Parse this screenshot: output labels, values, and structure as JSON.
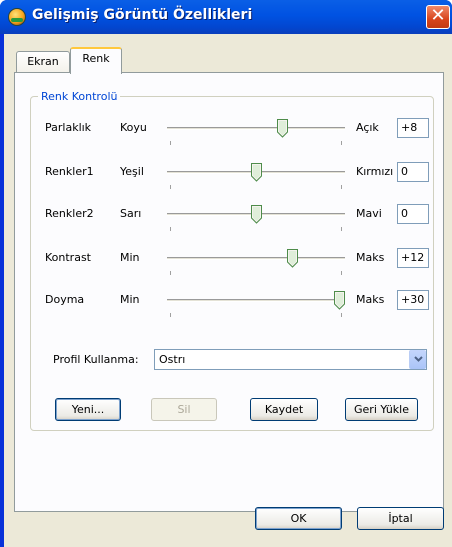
{
  "window": {
    "title": "Gelişmiş Görüntü Özellikleri",
    "close_glyph": "✕"
  },
  "tabs": [
    {
      "label": "Ekran"
    },
    {
      "label": "Renk"
    }
  ],
  "group": {
    "title": "Renk Kontrolü"
  },
  "sliders": [
    {
      "name": "Parlaklık",
      "low": "Koyu",
      "high": "Açık",
      "value": "+8",
      "position": 0.66
    },
    {
      "name": "Renkler1",
      "low": "Yeşil",
      "high": "Kırmızı",
      "value": "0",
      "position": 0.5
    },
    {
      "name": "Renkler2",
      "low": "Sarı",
      "high": "Mavi",
      "value": "0",
      "position": 0.5
    },
    {
      "name": "Kontrast",
      "low": "Min",
      "high": "Maks",
      "value": "+12",
      "position": 0.72
    },
    {
      "name": "Doyma",
      "low": "Min",
      "high": "Maks",
      "value": "+30",
      "position": 1.0
    }
  ],
  "profile": {
    "label": "Profil Kullanma:",
    "value": "Ostrı"
  },
  "buttons": {
    "new": "Yeni...",
    "delete": "Sil",
    "save": "Kaydet",
    "restore": "Geri Yükle",
    "ok": "OK",
    "cancel": "İptal"
  },
  "colors": {
    "title_bar": "#0055e5",
    "accent_label": "#0046d5",
    "panel": "#ece9d8",
    "close": "#d8451c"
  }
}
